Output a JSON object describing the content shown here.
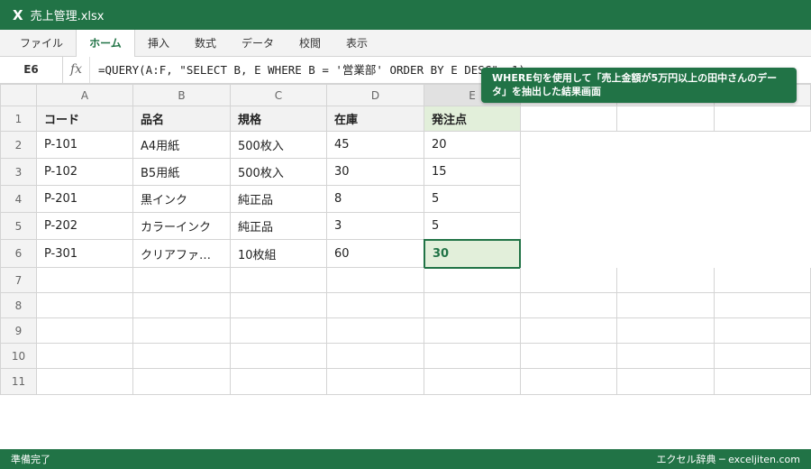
{
  "app": {
    "icon_letter": "X",
    "file_title": "売上管理.xlsx"
  },
  "ribbon": {
    "tabs": [
      "ファイル",
      "ホーム",
      "挿入",
      "数式",
      "データ",
      "校閲",
      "表示"
    ],
    "active_index": 1
  },
  "formula_bar": {
    "name_box": "E6",
    "fx_label": "fx",
    "formula": "=QUERY(A:F, \"SELECT B, E WHERE B = '営業部' ORDER BY E DESC\", 1)"
  },
  "sheet": {
    "columns": [
      "A",
      "B",
      "C",
      "D",
      "E"
    ],
    "row_numbers": [
      "1",
      "2",
      "3",
      "4",
      "5",
      "6",
      "7",
      "8",
      "9",
      "10",
      "11"
    ],
    "header_row": [
      "コード",
      "品名",
      "規格",
      "在庫",
      "発注点"
    ],
    "rows": [
      [
        "P-101",
        "A4用紙",
        "500枚入",
        "45",
        "20"
      ],
      [
        "P-102",
        "B5用紙",
        "500枚入",
        "30",
        "15"
      ],
      [
        "P-201",
        "黒インク",
        "純正品",
        "8",
        "5"
      ],
      [
        "P-202",
        "カラーインク",
        "純正品",
        "3",
        "5"
      ],
      [
        "P-301",
        "クリアファ…",
        "10枚組",
        "60",
        "30"
      ]
    ],
    "selected_cell": "E6"
  },
  "tooltip": {
    "text": "WHERE句を使用して「売上金額が5万円以上の田中さんのデータ」を抽出した結果画面"
  },
  "status": {
    "left": "準備完了",
    "right": "エクセル辞典 ─ exceljiten.com"
  },
  "colors": {
    "brand": "#217346",
    "selection_fill": "#e2efda"
  }
}
